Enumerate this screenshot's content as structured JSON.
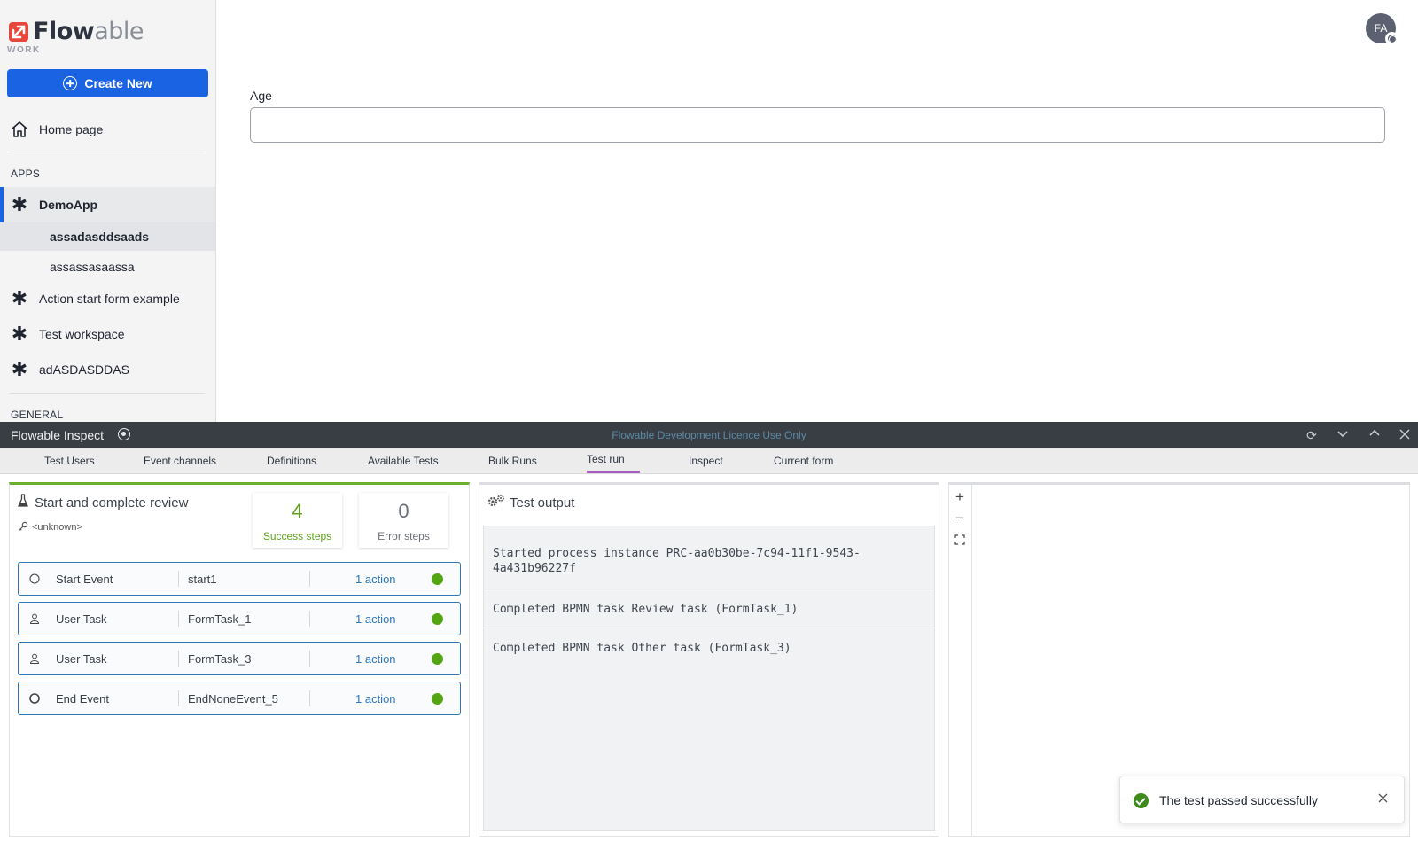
{
  "brand": {
    "name_strong": "Flow",
    "name_light": "able",
    "sub": "WORK"
  },
  "sidebar": {
    "create_label": "Create New",
    "home_label": "Home page",
    "apps_label": "APPS",
    "general_label": "GENERAL",
    "apps": [
      {
        "label": "DemoApp",
        "icon": "asterisk-icon"
      },
      {
        "label": "Action start form example",
        "icon": "asterisk-icon"
      },
      {
        "label": "Test workspace",
        "icon": "asterisk-icon"
      },
      {
        "label": "adASDASDDAS",
        "icon": "asterisk-icon"
      }
    ],
    "demo_children": [
      "assadasddsaads",
      "assassasaassa"
    ]
  },
  "user": {
    "initials": "FA"
  },
  "form": {
    "age_label": "Age",
    "age_value": ""
  },
  "inspect": {
    "title": "Flowable Inspect",
    "licence": "Flowable Development Licence Use Only",
    "tabs": [
      "Test Users",
      "Event channels",
      "Definitions",
      "Available Tests",
      "Bulk Runs",
      "Test run",
      "Inspect",
      "Current form"
    ],
    "active_tab": "Test run"
  },
  "test_run": {
    "title": "Start and complete review",
    "user": "<unknown>",
    "success_count": "4",
    "success_label": "Success steps",
    "error_count": "0",
    "error_label": "Error steps",
    "steps": [
      {
        "type": "Start Event",
        "id": "start1",
        "actions": "1 action",
        "status": "success"
      },
      {
        "type": "User Task",
        "id": "FormTask_1",
        "actions": "1 action",
        "status": "success"
      },
      {
        "type": "User Task",
        "id": "FormTask_3",
        "actions": "1 action",
        "status": "success"
      },
      {
        "type": "End Event",
        "id": "EndNoneEvent_5",
        "actions": "1 action",
        "status": "success"
      }
    ]
  },
  "output": {
    "title": "Test output",
    "lines": [
      "Started process instance PRC-aa0b30be-7c94-11f1-9543-4a431b96227f",
      "Completed BPMN task Review task (FormTask_1)",
      "Completed BPMN task Other task (FormTask_3)"
    ]
  },
  "toast": {
    "message": "The test passed successfully"
  },
  "colors": {
    "accent": "#1a63e2",
    "success": "#53a611",
    "bar": "#393e44",
    "tab_active": "#a85fc4"
  }
}
